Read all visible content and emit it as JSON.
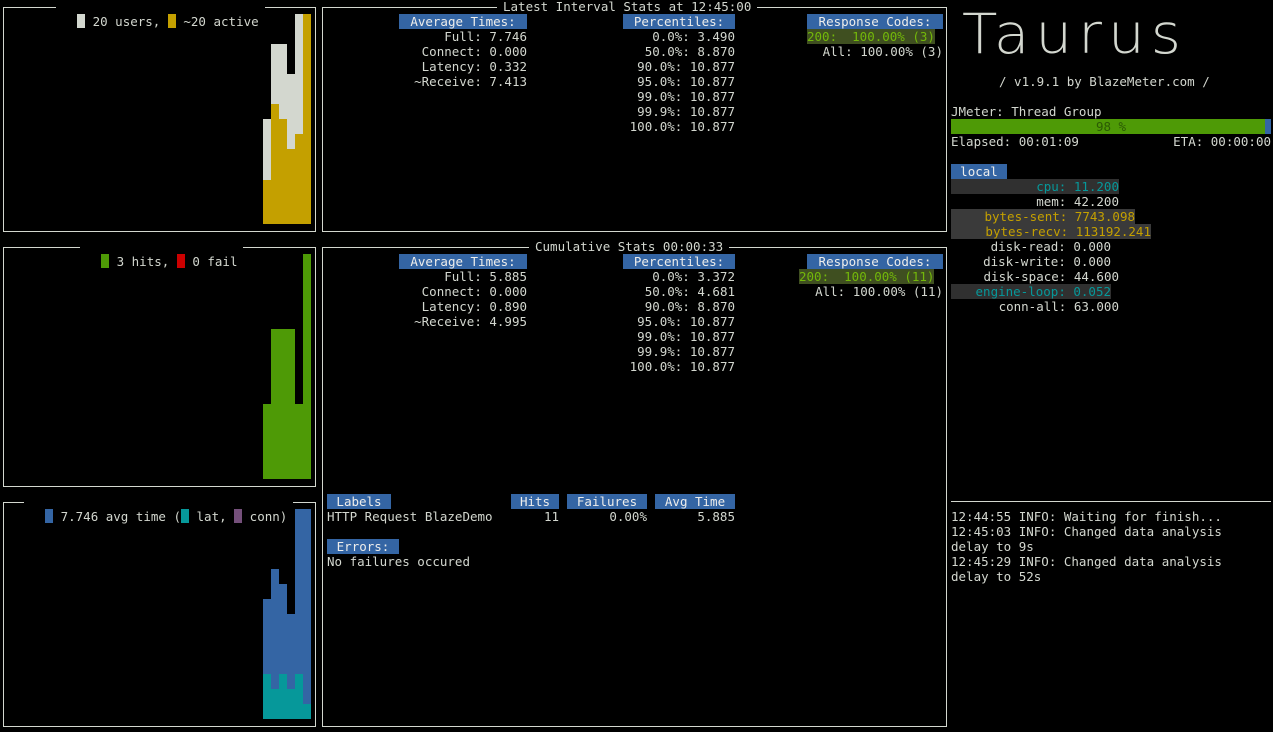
{
  "colors": {
    "users": "#d3d7cf",
    "active": "#c4a000",
    "hits": "#4e9a06",
    "fail": "#cc0000",
    "avg": "#3465a4",
    "lat": "#06989a",
    "conn": "#75507b"
  },
  "users_panel": {
    "label_users": " 20 users, ",
    "label_active": " ~20 active",
    "users_level": [
      0,
      0,
      0,
      0,
      0,
      0,
      0,
      0,
      0,
      0,
      0,
      0,
      0,
      0,
      0,
      0,
      0,
      0,
      0,
      0,
      0,
      0,
      0,
      0,
      0,
      0,
      0,
      0,
      0,
      0,
      0,
      0,
      0,
      0,
      0.5,
      1.0,
      1.0,
      1.0,
      1.0
    ],
    "active_level": [
      0,
      0,
      0,
      0,
      0,
      0,
      0,
      0,
      0,
      0,
      0,
      0,
      0,
      0,
      0,
      0,
      0,
      0,
      0,
      0,
      0,
      0,
      0,
      0,
      0,
      0,
      0,
      0,
      0,
      0,
      0,
      0,
      0,
      0,
      0.2,
      0.57,
      0.49,
      0.56,
      1.0
    ]
  },
  "hits_panel": {
    "label_hits": " 3 hits, ",
    "label_fail": " 0 fail"
  },
  "time_panel": {
    "label_avg": " 7.746 avg time (",
    "label_lat": " lat, ",
    "label_conn": " conn)"
  },
  "interval": {
    "title": "Latest Interval Stats at 12:45:00",
    "avg_header": "Average Times:",
    "avg_rows": [
      "Full: 7.746",
      "Connect: 0.000",
      "Latency: 0.332",
      "~Receive: 7.413"
    ],
    "pct_header": "Percentiles:",
    "pct_rows": [
      "0.0%: 3.490",
      "50.0%: 8.870",
      "90.0%: 10.877",
      "95.0%: 10.877",
      "99.0%: 10.877",
      "99.9%: 10.877",
      "100.0%: 10.877"
    ],
    "rc_header": "Response Codes:",
    "rc_200": "200:  100.00% (3)",
    "rc_all": "All: 100.00% (3)"
  },
  "cumulative": {
    "title": "Cumulative Stats 00:00:33",
    "avg_header": "Average Times:",
    "avg_rows": [
      "Full: 5.885",
      "Connect: 0.000",
      "Latency: 0.890",
      "~Receive: 4.995"
    ],
    "pct_header": "Percentiles:",
    "pct_rows": [
      "0.0%: 3.372",
      "50.0%: 4.681",
      "90.0%: 8.870",
      "95.0%: 10.877",
      "99.0%: 10.877",
      "99.9%: 10.877",
      "100.0%: 10.877"
    ],
    "rc_header": "Response Codes:",
    "rc_200": "200:  100.00% (11)",
    "rc_all": "All: 100.00% (11)",
    "table": {
      "headers": [
        "Labels",
        "Hits",
        "Failures",
        "Avg Time"
      ],
      "row": [
        "HTTP Request BlazeDemo",
        "11",
        "0.00%",
        "5.885"
      ]
    },
    "errors_header": "Errors:",
    "errors_text": "No failures occured"
  },
  "sidebar": {
    "logo": "Taurus",
    "version": "/ v1.9.1 by BlazeMeter.com /",
    "executor": "JMeter: Thread Group",
    "progress_text": "98 %",
    "progress_fraction": 0.98,
    "elapsed": "Elapsed: 00:01:09",
    "eta": "ETA: 00:00:00",
    "local_header": "local",
    "metrics": [
      {
        "label": "cpu: 11.200",
        "style": "cyan"
      },
      {
        "label": "mem: 42.200",
        "style": "plain"
      },
      {
        "label": "bytes-sent: 7743.098",
        "style": "yellow"
      },
      {
        "label": "bytes-recv: 113192.241",
        "style": "yellow"
      },
      {
        "label": "disk-read: 0.000",
        "style": "plain"
      },
      {
        "label": "disk-write: 0.000",
        "style": "plain"
      },
      {
        "label": "disk-space: 44.600",
        "style": "plain"
      },
      {
        "label": "engine-loop: 0.052",
        "style": "cyan"
      },
      {
        "label": "conn-all: 63.000",
        "style": "plain"
      }
    ],
    "log": [
      "12:44:55 INFO: Waiting for finish...",
      "12:45:03 INFO: Changed data analysis",
      "delay to 9s",
      "12:45:29 INFO: Changed data analysis",
      "delay to 52s"
    ]
  }
}
